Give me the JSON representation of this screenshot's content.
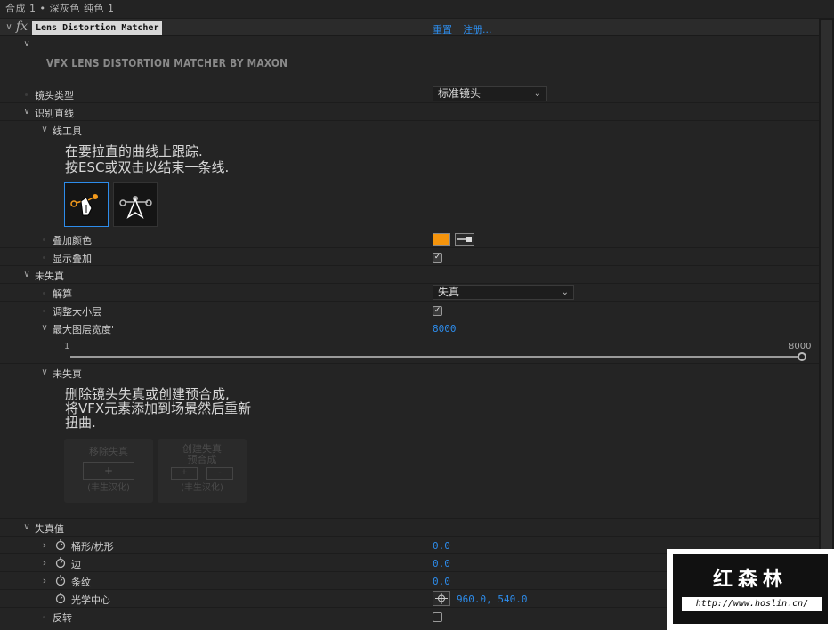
{
  "topbar": {
    "text": "合成 1 • 深灰色 纯色 1"
  },
  "header": {
    "fx": "fx",
    "title": "Lens Distortion Matcher",
    "reset": "重置",
    "register": "注册..."
  },
  "brand": {
    "text": "VFX LENS DISTORTION MATCHER BY MAXON"
  },
  "lens_type": {
    "label": "镜头类型",
    "value": "标准镜头"
  },
  "identify": {
    "label": "识别直线"
  },
  "line_tool": {
    "label": "线工具",
    "instr1": "在要拉直的曲线上跟踪.",
    "instr2": "按ESC或双击以结束一条线."
  },
  "overlay_color": {
    "label": "叠加颜色",
    "color": "#f5940c"
  },
  "show_overlay": {
    "label": "显示叠加"
  },
  "undistort": {
    "label": "未失真"
  },
  "solve": {
    "label": "解算",
    "value": "失真"
  },
  "resize_layer": {
    "label": "调整大小层"
  },
  "max_width": {
    "label": "最大图层宽度'",
    "value": "8000",
    "min": "1",
    "max": "8000",
    "level": 1.0
  },
  "undistort2": {
    "label": "未失真",
    "text1": "删除镜头失真或创建预合成,",
    "text2": "将VFX元素添加到场景然后重新",
    "text3": "扭曲.",
    "btn1_l1": "移除失真",
    "btn1_l2": "(丰生汉化)",
    "btn2_l1": "创建失真",
    "btn2_l2": "预合成",
    "btn2_l3": "(丰生汉化)"
  },
  "distortion": {
    "label": "失真值",
    "barrel": {
      "label": "桶形/枕形",
      "value": "0.0"
    },
    "edge": {
      "label": "边",
      "value": "0.0"
    },
    "stripe": {
      "label": "条纹",
      "value": "0.0"
    },
    "center": {
      "label": "光学中心",
      "value": "960.0, 540.0"
    },
    "invert": {
      "label": "反转"
    }
  },
  "watermark": {
    "cn": "红森林",
    "url": "http://www.hoslin.cn/"
  },
  "icons": [
    "stopwatch-icon",
    "chevron-down-icon",
    "chevron-right-icon",
    "pen-tool-icon",
    "pointer-tool-icon",
    "eyedropper-icon",
    "crosshair-icon"
  ]
}
